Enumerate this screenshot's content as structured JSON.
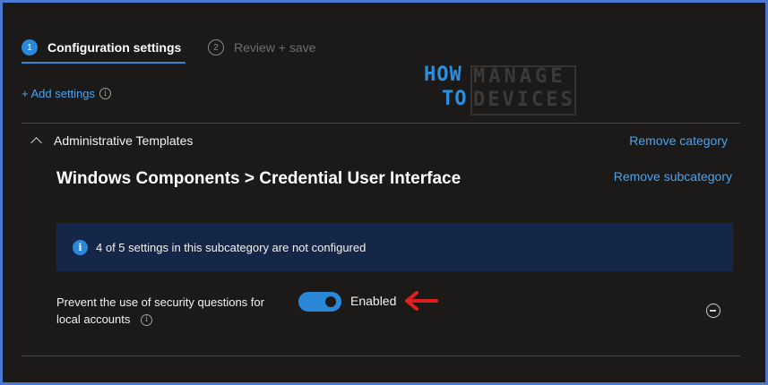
{
  "tabs": [
    {
      "step": "1",
      "label": "Configuration settings",
      "active": true
    },
    {
      "step": "2",
      "label": "Review + save",
      "active": false
    }
  ],
  "add_settings_label": "+ Add settings",
  "logo": {
    "how": "HOW",
    "to": "TO",
    "manage": "MANAGE",
    "devices": "DEVICES"
  },
  "category": {
    "title": "Administrative Templates",
    "remove_label": "Remove category"
  },
  "subcategory": {
    "title": "Windows Components > Credential User Interface",
    "remove_label": "Remove subcategory"
  },
  "info_banner": {
    "text": "4 of 5 settings in this subcategory are not configured"
  },
  "setting": {
    "label": "Prevent the use of security questions for local accounts",
    "state": "Enabled"
  },
  "colors": {
    "accent": "#2b88d8",
    "link": "#4aa3f0",
    "banner": "#142748",
    "arrow": "#e02020",
    "background": "#1b1a19"
  }
}
